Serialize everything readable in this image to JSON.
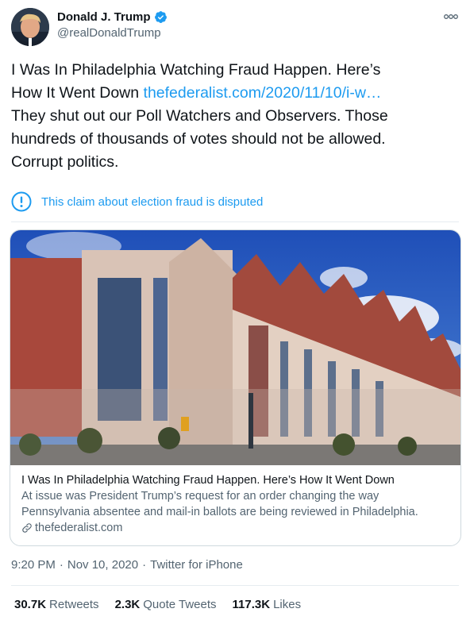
{
  "author": {
    "display_name": "Donald J. Trump",
    "handle": "@realDonaldTrump",
    "avatar_icon": "profile-photo",
    "verified_icon": "verified-badge-icon"
  },
  "tweet": {
    "line1": "I Was In Philadelphia Watching Fraud Happen. Here’s",
    "line2_text": "How It Went Down ",
    "line2_link": "thefederalist.com/2020/11/10/i-w…",
    "line3": "They shut out our Poll Watchers and Observers. Those",
    "line4": "hundreds of thousands of votes should not be allowed.",
    "line5": "Corrupt politics."
  },
  "label": {
    "text": "This claim about election fraud is disputed",
    "icon": "exclamation-circle-icon"
  },
  "card": {
    "image_alt": "Pennsylvania Convention Center building",
    "title": "I Was In Philadelphia Watching Fraud Happen. Here’s How It Went Down",
    "desc_line1": "At issue was President Trump’s request for an order changing the way",
    "desc_line2": "Pennsylvania absentee and mail-in ballots are being reviewed in Philadelphia.",
    "domain": "thefederalist.com"
  },
  "meta": {
    "time": "9:20 PM",
    "sep1": "·",
    "date": "Nov 10, 2020",
    "sep2": "·",
    "source": "Twitter for iPhone"
  },
  "stats": {
    "retweets_count": "30.7K",
    "retweets_label": "Retweets",
    "quotes_count": "2.3K",
    "quotes_label": "Quote Tweets",
    "likes_count": "117.3K",
    "likes_label": "Likes"
  },
  "colors": {
    "link": "#1d9bf0",
    "secondary_text": "#536471",
    "primary_text": "#0f1419",
    "border": "#cfd9de"
  }
}
